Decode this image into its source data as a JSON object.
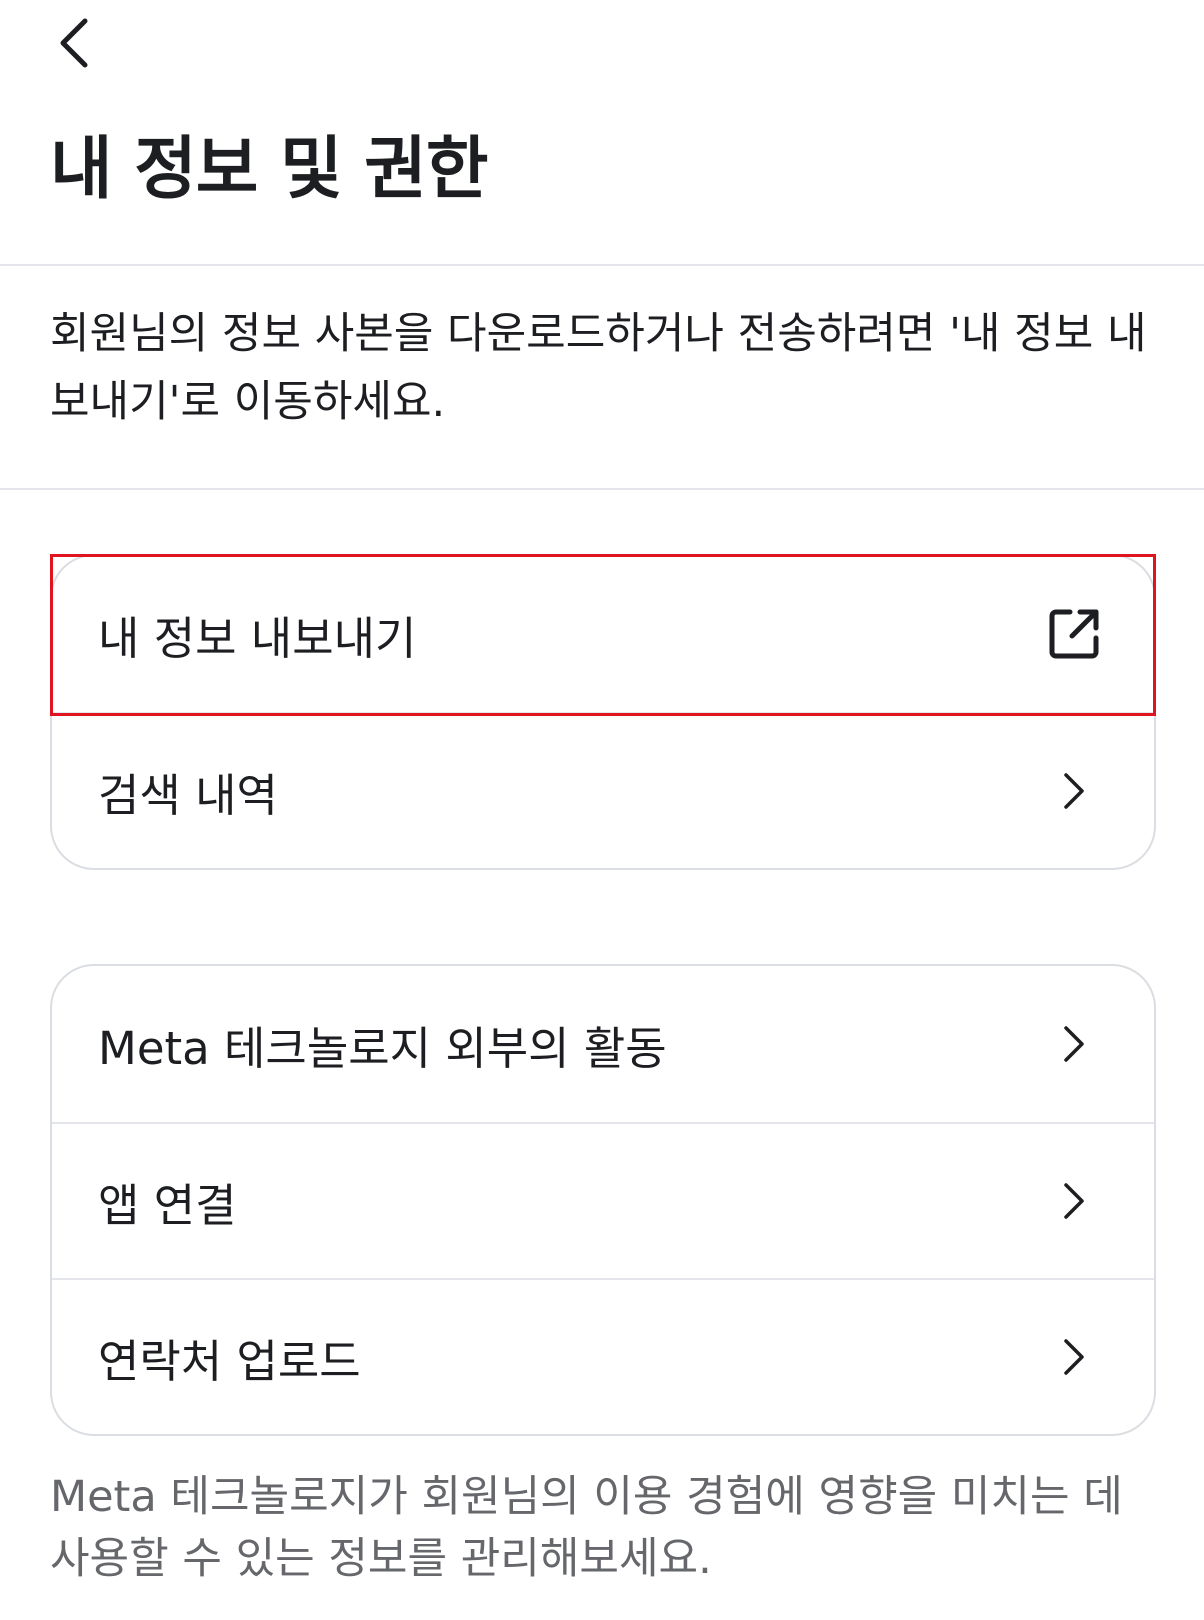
{
  "header": {
    "back_icon": "chevron-left-icon",
    "title": "내 정보 및 권한"
  },
  "description": "회원님의 정보 사본을 다운로드하거나 전송하려면 '내 정보 내보내기'로 이동하세요.",
  "card1": {
    "items": [
      {
        "label": "내 정보 내보내기",
        "icon": "external-link-icon"
      },
      {
        "label": "검색 내역",
        "icon": "chevron-right-icon"
      }
    ]
  },
  "card2": {
    "items": [
      {
        "label": "Meta 테크놀로지 외부의 활동",
        "icon": "chevron-right-icon"
      },
      {
        "label": "앱 연결",
        "icon": "chevron-right-icon"
      },
      {
        "label": "연락처 업로드",
        "icon": "chevron-right-icon"
      }
    ]
  },
  "footer": "Meta 테크놀로지가 회원님의 이용 경험에 영향을 미치는 데 사용할 수 있는 정보를 관리해보세요.",
  "colors": {
    "highlight": "#e0141e",
    "text_primary": "#1c1e21",
    "text_secondary": "#65676b",
    "divider": "#e4e6eb"
  }
}
